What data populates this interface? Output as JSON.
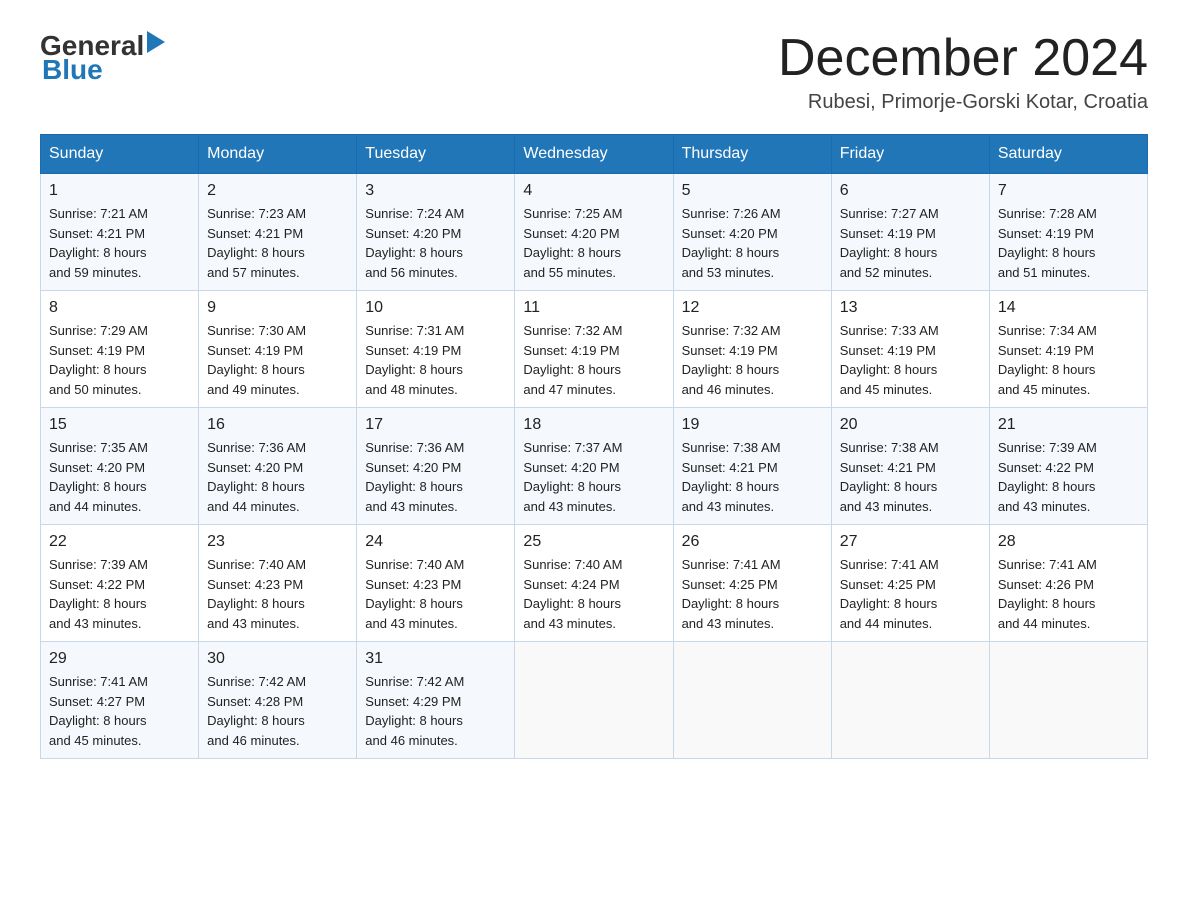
{
  "header": {
    "logo": {
      "general": "General",
      "arrow": "▶",
      "blue": "Blue"
    },
    "title": "December 2024",
    "location": "Rubesi, Primorje-Gorski Kotar, Croatia"
  },
  "weekdays": [
    "Sunday",
    "Monday",
    "Tuesday",
    "Wednesday",
    "Thursday",
    "Friday",
    "Saturday"
  ],
  "weeks": [
    [
      {
        "day": "1",
        "sunrise": "7:21 AM",
        "sunset": "4:21 PM",
        "daylight": "8 hours and 59 minutes."
      },
      {
        "day": "2",
        "sunrise": "7:23 AM",
        "sunset": "4:21 PM",
        "daylight": "8 hours and 57 minutes."
      },
      {
        "day": "3",
        "sunrise": "7:24 AM",
        "sunset": "4:20 PM",
        "daylight": "8 hours and 56 minutes."
      },
      {
        "day": "4",
        "sunrise": "7:25 AM",
        "sunset": "4:20 PM",
        "daylight": "8 hours and 55 minutes."
      },
      {
        "day": "5",
        "sunrise": "7:26 AM",
        "sunset": "4:20 PM",
        "daylight": "8 hours and 53 minutes."
      },
      {
        "day": "6",
        "sunrise": "7:27 AM",
        "sunset": "4:19 PM",
        "daylight": "8 hours and 52 minutes."
      },
      {
        "day": "7",
        "sunrise": "7:28 AM",
        "sunset": "4:19 PM",
        "daylight": "8 hours and 51 minutes."
      }
    ],
    [
      {
        "day": "8",
        "sunrise": "7:29 AM",
        "sunset": "4:19 PM",
        "daylight": "8 hours and 50 minutes."
      },
      {
        "day": "9",
        "sunrise": "7:30 AM",
        "sunset": "4:19 PM",
        "daylight": "8 hours and 49 minutes."
      },
      {
        "day": "10",
        "sunrise": "7:31 AM",
        "sunset": "4:19 PM",
        "daylight": "8 hours and 48 minutes."
      },
      {
        "day": "11",
        "sunrise": "7:32 AM",
        "sunset": "4:19 PM",
        "daylight": "8 hours and 47 minutes."
      },
      {
        "day": "12",
        "sunrise": "7:32 AM",
        "sunset": "4:19 PM",
        "daylight": "8 hours and 46 minutes."
      },
      {
        "day": "13",
        "sunrise": "7:33 AM",
        "sunset": "4:19 PM",
        "daylight": "8 hours and 45 minutes."
      },
      {
        "day": "14",
        "sunrise": "7:34 AM",
        "sunset": "4:19 PM",
        "daylight": "8 hours and 45 minutes."
      }
    ],
    [
      {
        "day": "15",
        "sunrise": "7:35 AM",
        "sunset": "4:20 PM",
        "daylight": "8 hours and 44 minutes."
      },
      {
        "day": "16",
        "sunrise": "7:36 AM",
        "sunset": "4:20 PM",
        "daylight": "8 hours and 44 minutes."
      },
      {
        "day": "17",
        "sunrise": "7:36 AM",
        "sunset": "4:20 PM",
        "daylight": "8 hours and 43 minutes."
      },
      {
        "day": "18",
        "sunrise": "7:37 AM",
        "sunset": "4:20 PM",
        "daylight": "8 hours and 43 minutes."
      },
      {
        "day": "19",
        "sunrise": "7:38 AM",
        "sunset": "4:21 PM",
        "daylight": "8 hours and 43 minutes."
      },
      {
        "day": "20",
        "sunrise": "7:38 AM",
        "sunset": "4:21 PM",
        "daylight": "8 hours and 43 minutes."
      },
      {
        "day": "21",
        "sunrise": "7:39 AM",
        "sunset": "4:22 PM",
        "daylight": "8 hours and 43 minutes."
      }
    ],
    [
      {
        "day": "22",
        "sunrise": "7:39 AM",
        "sunset": "4:22 PM",
        "daylight": "8 hours and 43 minutes."
      },
      {
        "day": "23",
        "sunrise": "7:40 AM",
        "sunset": "4:23 PM",
        "daylight": "8 hours and 43 minutes."
      },
      {
        "day": "24",
        "sunrise": "7:40 AM",
        "sunset": "4:23 PM",
        "daylight": "8 hours and 43 minutes."
      },
      {
        "day": "25",
        "sunrise": "7:40 AM",
        "sunset": "4:24 PM",
        "daylight": "8 hours and 43 minutes."
      },
      {
        "day": "26",
        "sunrise": "7:41 AM",
        "sunset": "4:25 PM",
        "daylight": "8 hours and 43 minutes."
      },
      {
        "day": "27",
        "sunrise": "7:41 AM",
        "sunset": "4:25 PM",
        "daylight": "8 hours and 44 minutes."
      },
      {
        "day": "28",
        "sunrise": "7:41 AM",
        "sunset": "4:26 PM",
        "daylight": "8 hours and 44 minutes."
      }
    ],
    [
      {
        "day": "29",
        "sunrise": "7:41 AM",
        "sunset": "4:27 PM",
        "daylight": "8 hours and 45 minutes."
      },
      {
        "day": "30",
        "sunrise": "7:42 AM",
        "sunset": "4:28 PM",
        "daylight": "8 hours and 46 minutes."
      },
      {
        "day": "31",
        "sunrise": "7:42 AM",
        "sunset": "4:29 PM",
        "daylight": "8 hours and 46 minutes."
      },
      null,
      null,
      null,
      null
    ]
  ],
  "labels": {
    "sunrise": "Sunrise:",
    "sunset": "Sunset:",
    "daylight": "Daylight:"
  }
}
